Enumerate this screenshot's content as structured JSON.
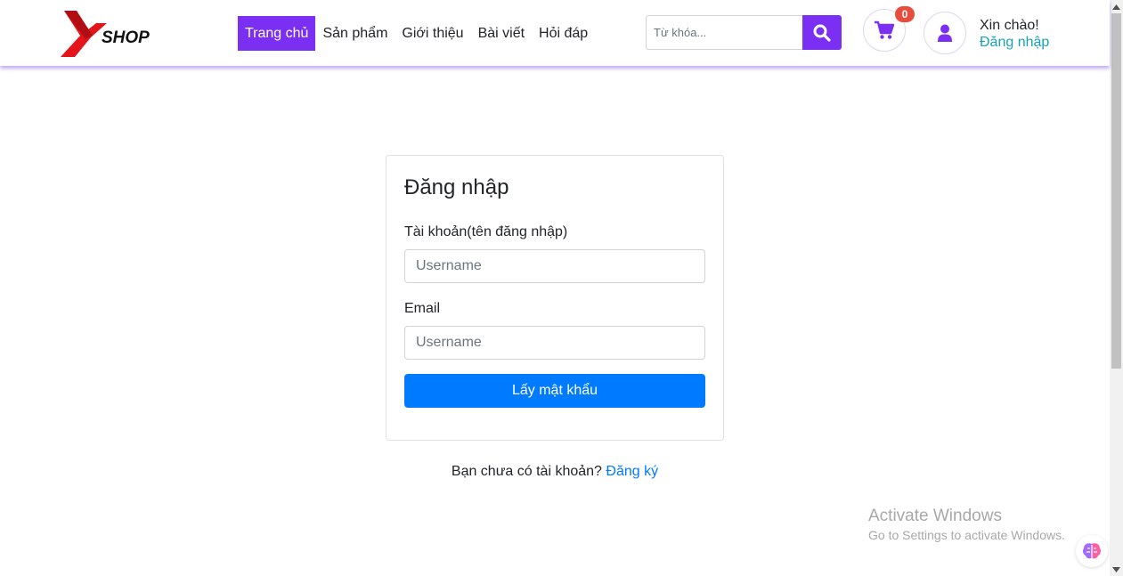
{
  "header": {
    "logo_text": "SHOP",
    "nav": [
      {
        "label": "Trang chủ",
        "active": true
      },
      {
        "label": "Sản phẩm",
        "active": false
      },
      {
        "label": "Giới thiệu",
        "active": false
      },
      {
        "label": "Bài viết",
        "active": false
      },
      {
        "label": "Hỏi đáp",
        "active": false
      }
    ],
    "search": {
      "placeholder": "Từ khóa..."
    },
    "cart": {
      "count": "0"
    },
    "greeting": "Xin chào!",
    "login_link": "Đăng nhập"
  },
  "form": {
    "title": "Đăng nhập",
    "account_label": "Tài khoản(tên đăng nhập)",
    "account_placeholder": "Username",
    "email_label": "Email",
    "email_placeholder": "Username",
    "submit_label": "Lấy mật khẩu"
  },
  "register": {
    "prompt": "Bạn chưa có tài khoản?",
    "link": "Đăng ký"
  },
  "watermark": {
    "title": "Activate Windows",
    "subtitle": "Go to Settings to activate Windows."
  },
  "colors": {
    "accent": "#7b2ff2",
    "primary": "#007bff",
    "badge": "#e74c3c",
    "link_teal": "#17a2b8"
  }
}
